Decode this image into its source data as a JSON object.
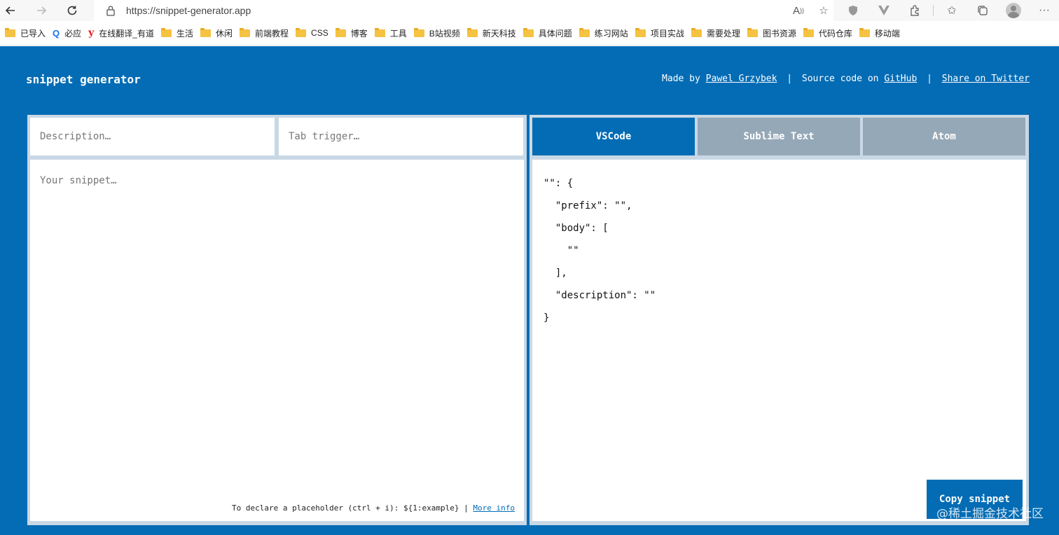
{
  "browser": {
    "url": "https://snippet-generator.app",
    "bookmarks": [
      {
        "label": "已导入",
        "icon": "folder-icon"
      },
      {
        "label": "必应",
        "icon": "search-icon"
      },
      {
        "label": "在线翻译_有道",
        "icon": "youdao-icon"
      },
      {
        "label": "生活",
        "icon": "folder-icon"
      },
      {
        "label": "休闲",
        "icon": "folder-icon"
      },
      {
        "label": "前端教程",
        "icon": "folder-icon"
      },
      {
        "label": "CSS",
        "icon": "folder-icon"
      },
      {
        "label": "博客",
        "icon": "folder-icon"
      },
      {
        "label": "工具",
        "icon": "folder-icon"
      },
      {
        "label": "B站视频",
        "icon": "folder-icon"
      },
      {
        "label": "新天科技",
        "icon": "folder-icon"
      },
      {
        "label": "具体问题",
        "icon": "folder-icon"
      },
      {
        "label": "练习网站",
        "icon": "folder-icon"
      },
      {
        "label": "项目实战",
        "icon": "folder-icon"
      },
      {
        "label": "需要处理",
        "icon": "folder-icon"
      },
      {
        "label": "图书资源",
        "icon": "folder-icon"
      },
      {
        "label": "代码仓库",
        "icon": "folder-icon"
      },
      {
        "label": "移动端",
        "icon": "folder-icon"
      }
    ]
  },
  "header": {
    "logo": "snippet generator",
    "made_by": "Made by",
    "author": "Pawel Grzybek",
    "pipe1": "|",
    "source_prefix": "Source code on",
    "github": "GitHub",
    "pipe2": "|",
    "share": "Share on Twitter"
  },
  "inputs": {
    "description_placeholder": "Description…",
    "tab_trigger_placeholder": "Tab trigger…",
    "snippet_placeholder": "Your snippet…",
    "hint_text": "To declare a placeholder (ctrl + i): ${1:example} |",
    "hint_link": "More info"
  },
  "tabs": [
    {
      "label": "VSCode",
      "active": true
    },
    {
      "label": "Sublime Text",
      "active": false
    },
    {
      "label": "Atom",
      "active": false
    }
  ],
  "output": {
    "code_lines": [
      "\"\": {",
      "  \"prefix\": \"\",",
      "  \"body\": [",
      "    \"\"",
      "  ],",
      "  \"description\": \"\"",
      "}"
    ]
  },
  "copy_button": "Copy snippet",
  "watermark": "@稀土掘金技术社区",
  "colors": {
    "brand": "#036cb5",
    "inactive_tab": "#95a8b7",
    "panel_border": "#c9d8e5"
  }
}
